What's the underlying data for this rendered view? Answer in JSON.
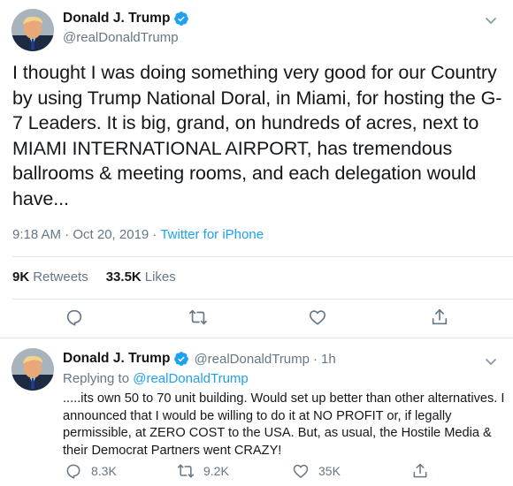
{
  "main_tweet": {
    "author": {
      "display_name": "Donald J. Trump",
      "handle": "@realDonaldTrump",
      "verified": true
    },
    "text": "I thought I was doing something very good for our Country by using Trump National Doral, in Miami, for hosting the G-7 Leaders. It is big, grand, on hundreds of acres, next to MIAMI INTERNATIONAL AIRPORT, has tremendous ballrooms & meeting rooms, and each delegation would have...",
    "timestamp": "9:18 AM · Oct 20, 2019",
    "separator": " · ",
    "source": "Twitter for iPhone",
    "stats": {
      "retweets_count": "9K",
      "retweets_label": "Retweets",
      "likes_count": "33.5K",
      "likes_label": "Likes"
    },
    "actions": [
      "reply-icon",
      "retweet-icon",
      "like-icon",
      "share-icon"
    ]
  },
  "reply_tweet": {
    "author": {
      "display_name": "Donald J. Trump",
      "handle": "@realDonaldTrump",
      "verified": true
    },
    "separator": "·",
    "time": "1h",
    "replying_prefix": "Replying to ",
    "replying_to": "@realDonaldTrump",
    "text": ".....its own 50 to 70 unit building. Would set up better than other alternatives. I announced that I would be willing to do it at NO PROFIT or, if legally permissible, at ZERO COST to the USA. But, as usual, the Hostile Media & their Democrat Partners went CRAZY!",
    "reply_count": "8.3K",
    "retweet_count": "9.2K",
    "like_count": "35K"
  },
  "colors": {
    "primary_text": "#14171a",
    "secondary_text": "#657786",
    "link_blue": "#1da1f2",
    "divider": "#e1e8ed"
  }
}
